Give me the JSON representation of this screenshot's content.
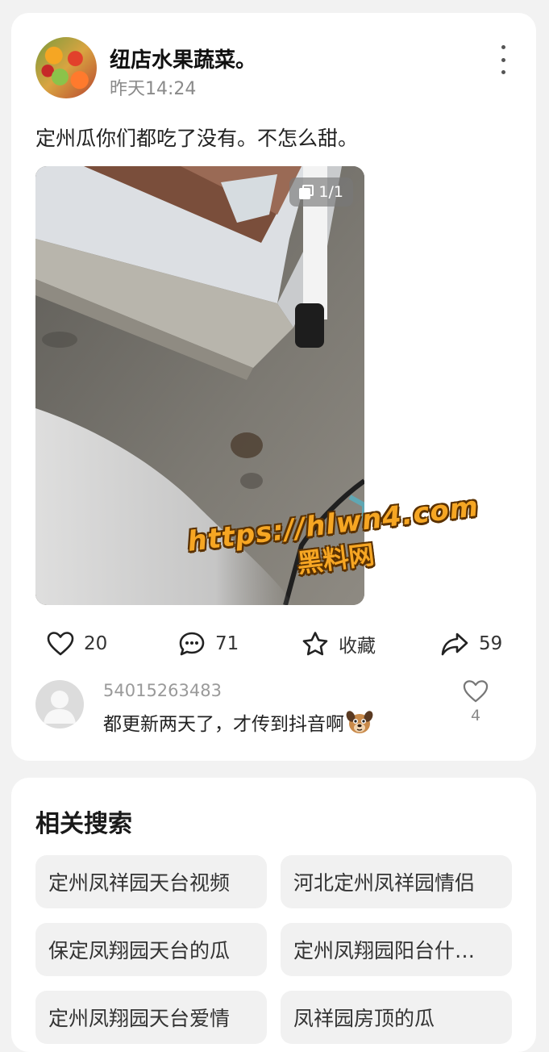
{
  "post": {
    "username": "纽店水果蔬菜。",
    "timestamp": "昨天14:24",
    "text": "定州瓜你们都吃了没有。不怎么甜。",
    "image_counter": "1/1",
    "watermark": {
      "url": "https://hlwn4.com",
      "name": "黑料网"
    },
    "actions": {
      "like_count": "20",
      "comment_count": "71",
      "favorite_label": "收藏",
      "share_count": "59"
    },
    "comment": {
      "user": "54015263483",
      "text": "都更新两天了，才传到抖音啊",
      "like_count": "4"
    }
  },
  "related": {
    "title": "相关搜索",
    "items": [
      "定州凤祥园天台视频",
      "河北定州凤祥园情侣",
      "保定凤翔园天台的瓜",
      "定州凤翔园阳台什…",
      "定州凤翔园天台爱情",
      "凤祥园房顶的瓜"
    ]
  },
  "icons": {
    "more": "more-vertical-icon",
    "image_counter": "image-stack-icon",
    "like": "heart-icon",
    "comment": "comment-bubble-icon",
    "favorite": "star-icon",
    "share": "share-arrow-icon",
    "comment_like": "heart-icon",
    "emoji": "dog-face-emoji"
  }
}
